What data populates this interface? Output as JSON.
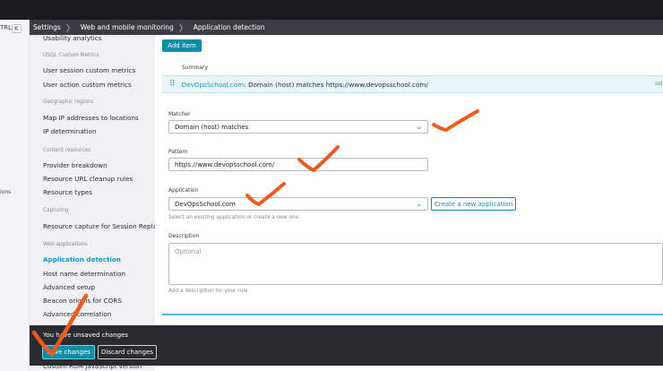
{
  "rail": {
    "kbd_left": "TRL",
    "kbd_key": "K",
    "partial_label": "ions"
  },
  "breadcrumb": [
    "Settings",
    "Web and mobile monitoring",
    "Application detection"
  ],
  "nav": {
    "top_partial": "Usability analytics",
    "group_usql": "USQL Custom Metrics",
    "user_session_metrics": "User session custom metrics",
    "user_action_metrics": "User action custom metrics",
    "group_geo": "Geographic regions",
    "map_ip": "Map IP addresses to locations",
    "ip_determination": "IP determination",
    "group_content": "Content resources",
    "provider_breakdown": "Provider breakdown",
    "resource_url_cleanup": "Resource URL cleanup rules",
    "resource_types": "Resource types",
    "group_capturing": "Capturing",
    "resource_capture": "Resource capture for Session Replay",
    "group_web": "Web applications",
    "application_detection": "Application detection",
    "host_name_determination": "Host name determination",
    "advanced_setup": "Advanced setup",
    "beacon_origins": "Beacon origins for CORS",
    "advanced_correlation": "Advanced correlation",
    "bottom_partial": "Custom RUM JavaScript version"
  },
  "main": {
    "add_item_label": "Add item",
    "summary_header": "Summary",
    "summary_app": "DevOpsSchool.com",
    "summary_rest": ": Domain (host) matches https://www.devopsschool.com/",
    "summary_tag": "set",
    "matcher_label": "Matcher",
    "matcher_value": "Domain (host) matches",
    "pattern_label": "Pattern",
    "pattern_value": "https://www.devopsschool.com/",
    "application_label": "Application",
    "application_value": "DevOpsSchool.com",
    "create_app_label": "Create a new application",
    "application_helper": "Select an existing application or create a new one.",
    "description_label": "Description",
    "description_placeholder": "Optional",
    "description_helper": "Add a description for your rule"
  },
  "footer": {
    "message": "You have unsaved changes",
    "save_label": "Save changes",
    "discard_label": "Discard changes"
  },
  "colors": {
    "accent": "#0c8fa6",
    "active_link": "#1496c8",
    "annotation": "#f05a1a",
    "footer_bg": "#2a2b30"
  },
  "icons": {
    "drag": "drag-handle-icon",
    "chevron": "chevron-down-icon",
    "separator": "chevron-right-icon"
  }
}
